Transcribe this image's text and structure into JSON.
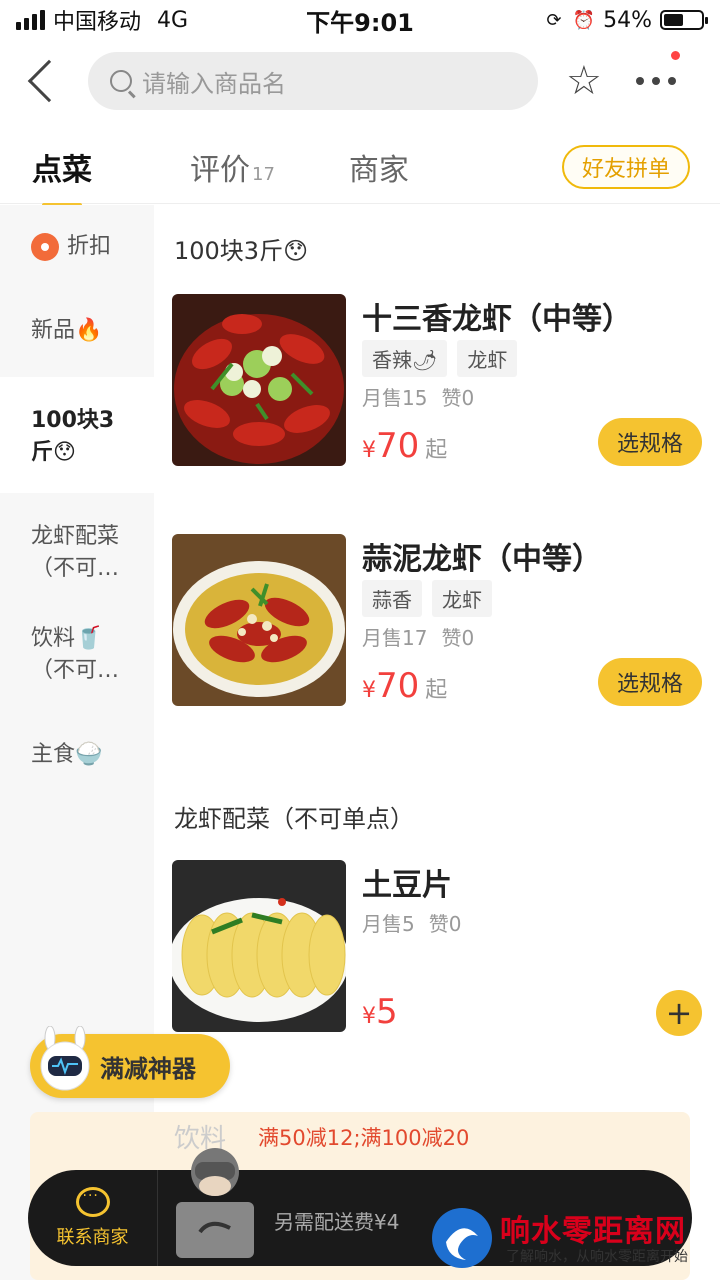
{
  "status": {
    "carrier": "中国移动",
    "network": "4G",
    "time": "下午9:01",
    "battery": "54%",
    "battery_level": 0.54
  },
  "search": {
    "placeholder": "请输入商品名"
  },
  "tabs": [
    {
      "label": "点菜",
      "active": true
    },
    {
      "label": "评价",
      "count": "17"
    },
    {
      "label": "商家"
    }
  ],
  "friend_button": "好友拼单",
  "sidebar": {
    "items": [
      {
        "label": "折扣"
      },
      {
        "label": "新品🔥"
      },
      {
        "label": "100块3",
        "label2": "斤😯",
        "active": true
      },
      {
        "label": "龙虾配菜",
        "label2": "（不可…"
      },
      {
        "label": "饮料🥤",
        "label2": "（不可…"
      },
      {
        "label": "主食🍚"
      }
    ]
  },
  "sections": [
    {
      "title": "100块3斤😯"
    },
    {
      "title": "龙虾配菜（不可单点）"
    }
  ],
  "dishes": [
    {
      "name": "十三香龙虾（中等）",
      "tags": [
        "香辣🌶",
        "龙虾"
      ],
      "sales": "月售15",
      "likes": "赞0",
      "currency": "¥",
      "price": "70",
      "suffix": "起",
      "button": "选规格"
    },
    {
      "name": "蒜泥龙虾（中等）",
      "tags": [
        "蒜香",
        "龙虾"
      ],
      "sales": "月售17",
      "likes": "赞0",
      "currency": "¥",
      "price": "70",
      "suffix": "起",
      "button": "选规格"
    },
    {
      "name": "土豆片",
      "sales": "月售5",
      "likes": "赞0",
      "currency": "¥",
      "price": "5",
      "button": "+"
    }
  ],
  "promo_float": "满减神器",
  "faded_section": "饮料",
  "discount": "满50减12;满100减20",
  "cart": {
    "contact_label": "联系商家",
    "delivery_fee": "另需配送费¥4"
  },
  "watermark": {
    "title": "响水零距离网",
    "subtitle": "了解响水，从响水零距离开始"
  },
  "colors": {
    "accent": "#f5c330",
    "price": "#f2403d"
  }
}
